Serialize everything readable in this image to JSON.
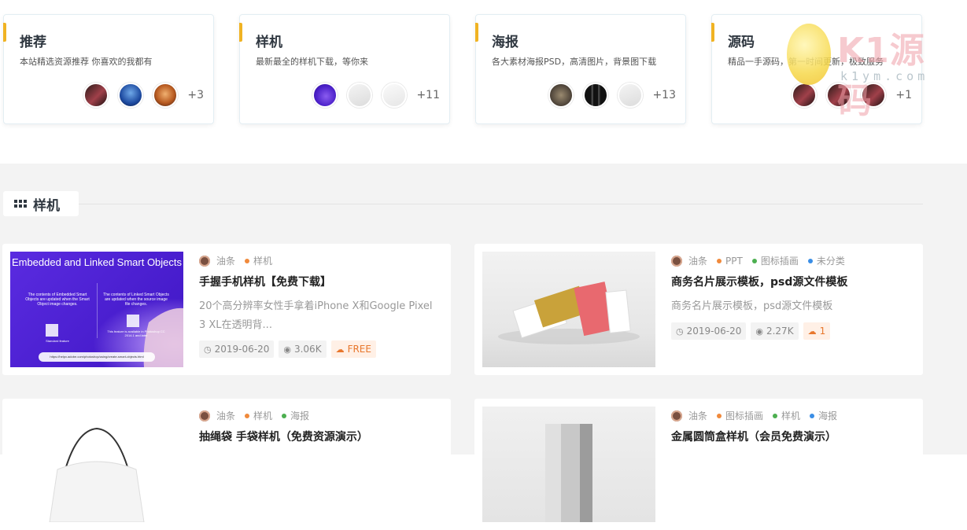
{
  "categories": [
    {
      "title": "推荐",
      "desc": "本站精选资源推荐 你喜欢的我都有",
      "count": "+3"
    },
    {
      "title": "样机",
      "desc": "最新最全的样机下载，等你来",
      "count": "+11"
    },
    {
      "title": "海报",
      "desc": "各大素材海报PSD，高清图片，背景图下载",
      "count": "+13"
    },
    {
      "title": "源码",
      "desc": "精品一手源码，第一时间更新，极致服务",
      "count": "+1"
    }
  ],
  "section": {
    "title": "样机",
    "icon": "grid-icon"
  },
  "posts": [
    {
      "author": "油条",
      "tags": [
        {
          "label": "样机",
          "color": "#f08a3c"
        }
      ],
      "title": "手握手机样机【免费下载】",
      "excerpt": "20个高分辨率女性手拿着iPhone X和Google Pixel 3 XL在透明背...",
      "date": "2019-06-20",
      "views": "3.06K",
      "price": "FREE",
      "thumb": {
        "heading": "Embedded and Linked Smart Objects",
        "col1": "The contents of Embedded Smart Objects are updated when the Smart Object image changes.",
        "col2": "The contents of Linked Smart Objects are updated when the source image file changes.",
        "label1": "Standard feature",
        "label2": "This feature is available in Photoshop CC 2014.1 and later",
        "url": "https://helpx.adobe.com/photoshop/using/create-smart-objects.html"
      }
    },
    {
      "author": "油条",
      "tags": [
        {
          "label": "PPT",
          "color": "#f08a3c"
        },
        {
          "label": "图标插画",
          "color": "#4caf50"
        },
        {
          "label": "未分类",
          "color": "#3a8ee6"
        }
      ],
      "title": "商务名片展示模板，psd源文件模板",
      "excerpt": "商务名片展示模板，psd源文件模板",
      "date": "2019-06-20",
      "views": "2.27K",
      "price": "1"
    },
    {
      "author": "油条",
      "tags": [
        {
          "label": "样机",
          "color": "#f08a3c"
        },
        {
          "label": "海报",
          "color": "#4caf50"
        }
      ],
      "title": "抽绳袋 手袋样机（免费资源演示）"
    },
    {
      "author": "油条",
      "tags": [
        {
          "label": "图标插画",
          "color": "#f08a3c"
        },
        {
          "label": "样机",
          "color": "#4caf50"
        },
        {
          "label": "海报",
          "color": "#3a8ee6"
        }
      ],
      "title": "金属圆筒盒样机（会员免费演示）"
    }
  ],
  "watermark": {
    "brand": "K1源码",
    "url": "k1ym.com"
  }
}
